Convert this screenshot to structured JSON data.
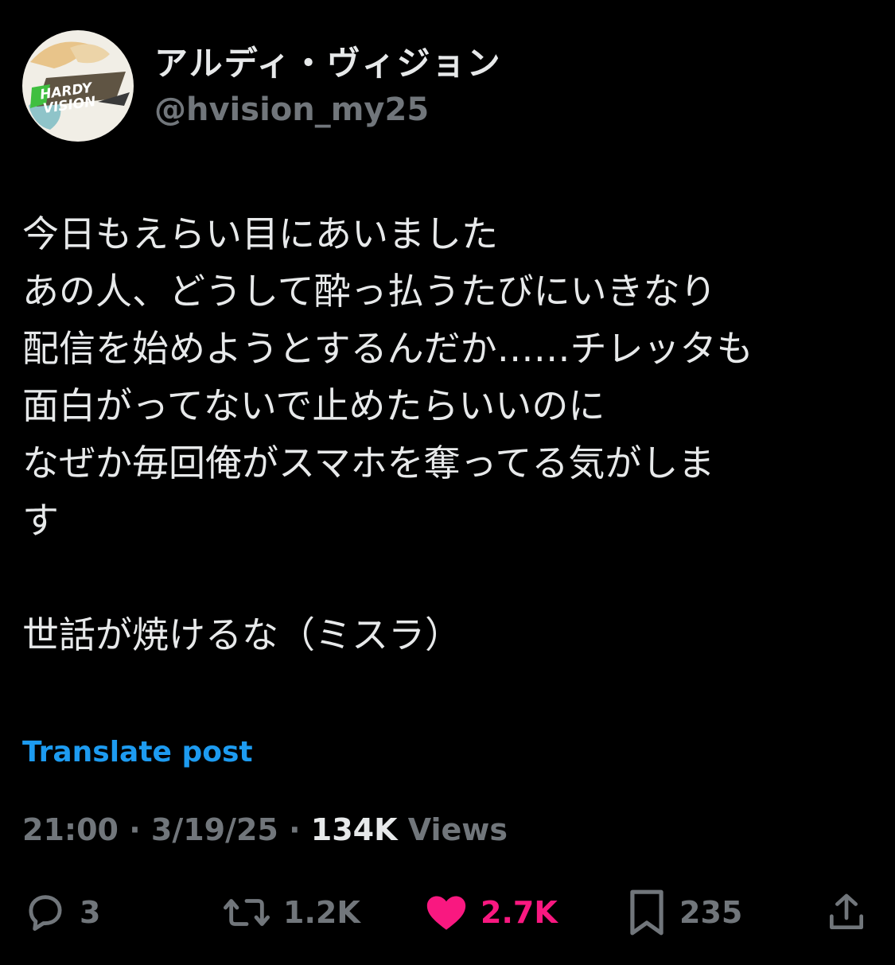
{
  "author": {
    "display_name": "アルディ・ヴィジョン",
    "handle": "@hvision_my25",
    "avatar_logo_text": "HARDY VISION"
  },
  "post": {
    "lines": [
      "今日もえらい目にあいました",
      "あの人、どうして酔っ払うたびにいきなり",
      "配信を始めようとするんだか……チレッタも",
      "面白がってないで止めたらいいのに",
      "なぜか毎回俺がスマホを奪ってる気がしま",
      "す",
      "",
      "世話が焼けるな（ミスラ）"
    ],
    "translate_label": "Translate post"
  },
  "meta": {
    "time": "21:00",
    "separator": " · ",
    "date": "3/19/25",
    "views_count": "134K",
    "views_label": " Views"
  },
  "actions": {
    "replies": "3",
    "reposts": "1.2K",
    "likes": "2.7K",
    "bookmarks": "235"
  },
  "colors": {
    "background": "#000000",
    "text": "#e7e9ea",
    "secondary": "#71767b",
    "link": "#1d9bf0",
    "like": "#f91880"
  },
  "icons": [
    "reply-icon",
    "repost-icon",
    "heart-icon",
    "bookmark-icon",
    "share-icon"
  ]
}
